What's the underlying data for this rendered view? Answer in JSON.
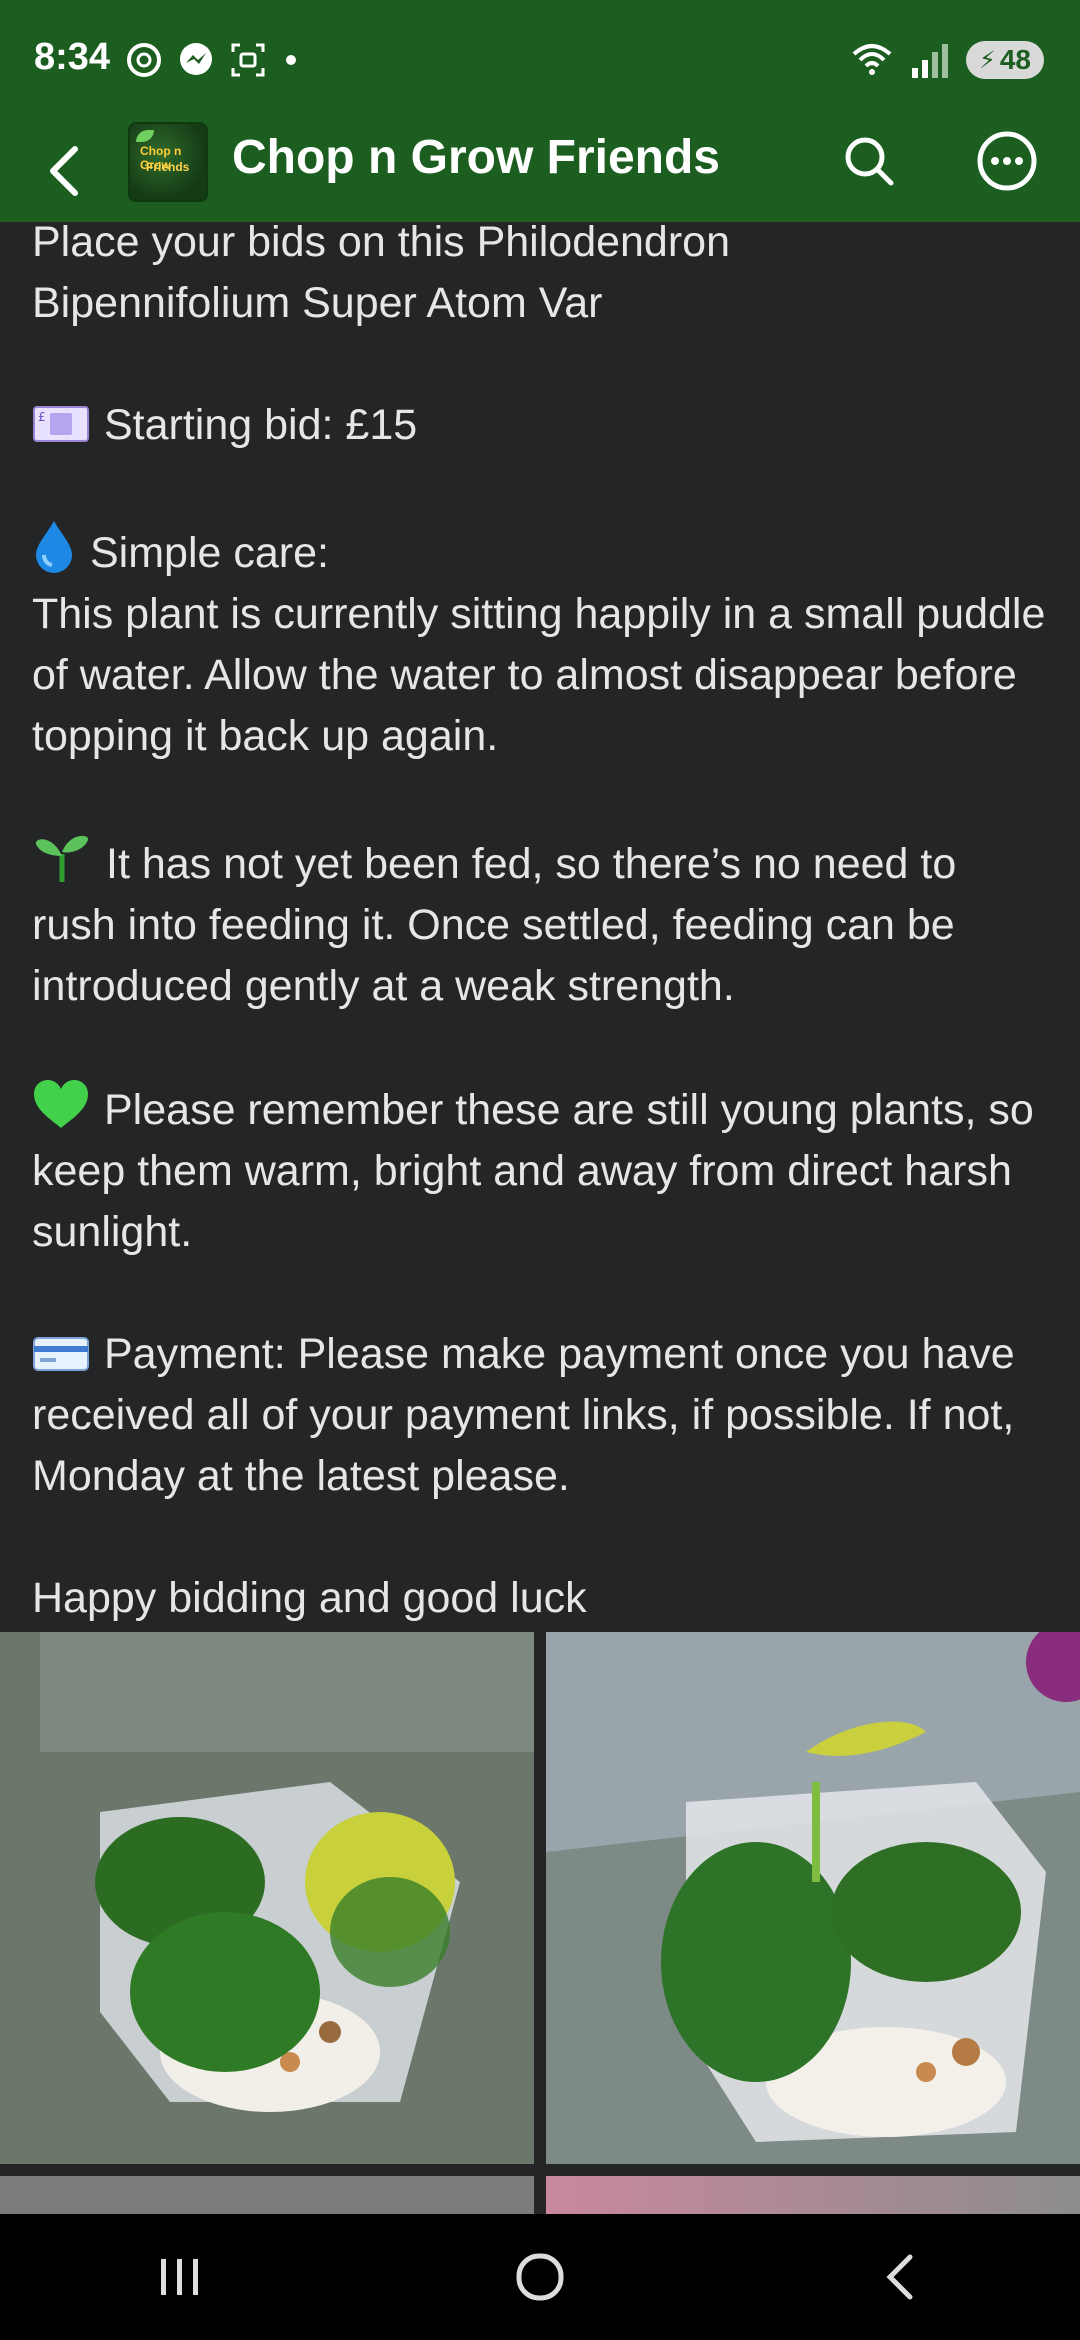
{
  "status_bar": {
    "time": "8:34",
    "battery": "48",
    "icons": [
      "threads-icon",
      "messenger-icon",
      "screenshot-icon",
      "wifi-icon",
      "signal-icon",
      "battery-icon"
    ]
  },
  "app_bar": {
    "group_name": "Chop n Grow Friends",
    "logo_text_line1": "Chop n Grow",
    "logo_text_line2": "Friends",
    "icons": [
      "back-arrow-icon",
      "search-icon",
      "more-icon"
    ]
  },
  "post": {
    "intro_line1": "Place your bids on this Philodendron",
    "intro_line2": "Bipennifolium Super Atom Var",
    "starting_bid": "Starting bid: £15",
    "care_heading": "Simple care:",
    "care_text": "This plant is currently sitting happily in a small puddle of water. Allow the water to almost disappear before topping it back up again.",
    "feeding_text": "It has not yet been fed, so there’s no need to rush into feeding it. Once settled, feeding can be introduced gently at a weak strength.",
    "young_text": "Please remember these are still young plants, so keep them warm, bright and away from direct harsh sunlight.",
    "payment_text": "Payment: Please make payment once you have received all of your payment links, if possible. If not, Monday at the latest please.",
    "closing": "Happy bidding and good luck"
  },
  "colors": {
    "header_green": "#1b5e20",
    "background": "#242526",
    "text": "#e6e6e6"
  }
}
